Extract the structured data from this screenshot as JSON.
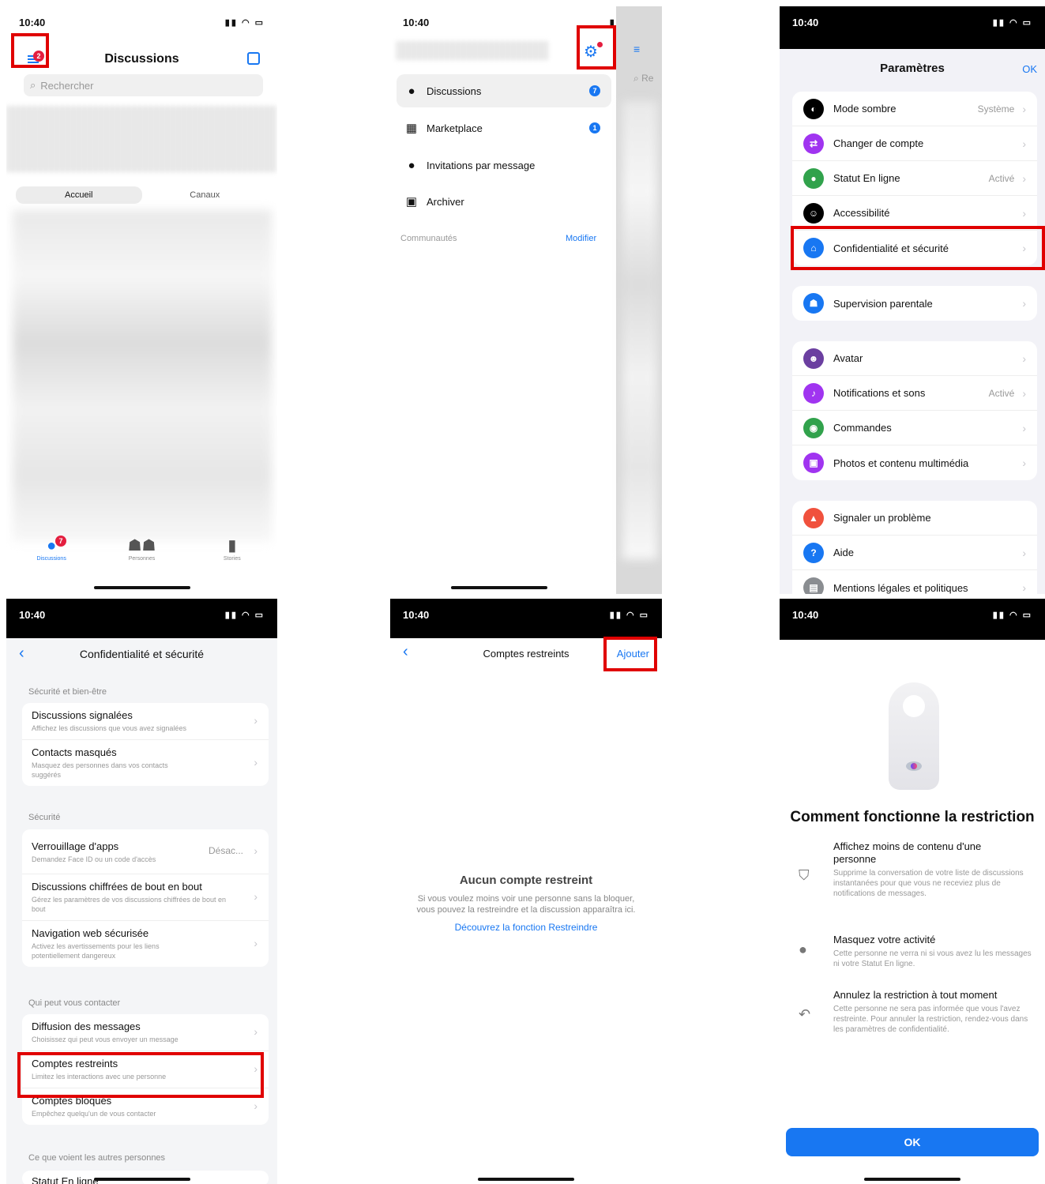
{
  "status_time": "10:40",
  "p1": {
    "title": "Discussions",
    "menu_badge": "2",
    "search_placeholder": "Rechercher",
    "seg_home": "Accueil",
    "seg_channels": "Canaux",
    "tabs": [
      {
        "label": "Discussions",
        "badge": "7"
      },
      {
        "label": "Personnes"
      },
      {
        "label": "Stories"
      }
    ]
  },
  "p2": {
    "items": [
      {
        "label": "Discussions",
        "badge": "7"
      },
      {
        "label": "Marketplace",
        "badge": "1"
      },
      {
        "label": "Invitations par message"
      },
      {
        "label": "Archiver"
      }
    ],
    "communities": "Communautés",
    "modify": "Modifier",
    "peek_search": "Re"
  },
  "p3": {
    "title": "Paramètres",
    "ok": "OK",
    "groups": [
      [
        {
          "label": "Mode sombre",
          "value": "Système",
          "color": "#000000"
        },
        {
          "label": "Changer de compte",
          "value": "",
          "color": "#a034f0"
        },
        {
          "label": "Statut En ligne",
          "value": "Activé",
          "color": "#31a24c"
        },
        {
          "label": "Accessibilité",
          "value": "",
          "color": "#000000"
        },
        {
          "label": "Confidentialité et sécurité",
          "value": "",
          "color": "#1877f2"
        }
      ],
      [
        {
          "label": "Supervision parentale",
          "value": "",
          "color": "#1877f2"
        }
      ],
      [
        {
          "label": "Avatar",
          "value": "",
          "color": "#6b3fa0"
        },
        {
          "label": "Notifications et sons",
          "value": "Activé",
          "color": "#a034f0"
        },
        {
          "label": "Commandes",
          "value": "",
          "color": "#31a24c"
        },
        {
          "label": "Photos et contenu multimédia",
          "value": "",
          "color": "#a034f0"
        }
      ],
      [
        {
          "label": "Signaler un problème",
          "value": "",
          "color": "#f0513d"
        },
        {
          "label": "Aide",
          "value": "",
          "color": "#1877f2"
        },
        {
          "label": "Mentions légales et politiques",
          "value": "",
          "color": "#8a8d91"
        }
      ]
    ]
  },
  "p4": {
    "title": "Confidentialité et sécurité",
    "sections": [
      {
        "label": "Sécurité et bien-être",
        "rows": [
          {
            "title": "Discussions signalées",
            "sub": "Affichez les discussions que vous avez signalées",
            "value": ""
          },
          {
            "title": "Contacts masqués",
            "sub": "Masquez des personnes dans vos contacts suggérés",
            "value": ""
          }
        ]
      },
      {
        "label": "Sécurité",
        "rows": [
          {
            "title": "Verrouillage d'apps",
            "sub": "Demandez Face ID ou un code d'accès",
            "value": "Désac..."
          },
          {
            "title": "Discussions chiffrées de bout en bout",
            "sub": "Gérez les paramètres de vos discussions chiffrées de bout en bout",
            "value": ""
          },
          {
            "title": "Navigation web sécurisée",
            "sub": "Activez les avertissements pour les liens potentiellement dangereux",
            "value": ""
          }
        ]
      },
      {
        "label": "Qui peut vous contacter",
        "rows": [
          {
            "title": "Diffusion des messages",
            "sub": "Choisissez qui peut vous envoyer un message",
            "value": ""
          },
          {
            "title": "Comptes restreints",
            "sub": "Limitez les interactions avec une personne",
            "value": ""
          },
          {
            "title": "Comptes bloqués",
            "sub": "Empêchez quelqu'un de vous contacter",
            "value": ""
          }
        ]
      },
      {
        "label": "Ce que voient les autres personnes",
        "rows": [
          {
            "title": "Statut En ligne",
            "sub": "",
            "value": ""
          }
        ]
      }
    ]
  },
  "p5": {
    "title": "Comptes restreints",
    "add": "Ajouter",
    "empty_title": "Aucun compte restreint",
    "empty_body": "Si vous voulez moins voir une personne sans la bloquer, vous pouvez la restreindre et la discussion apparaîtra ici.",
    "link": "Découvrez la fonction Restreindre"
  },
  "p6": {
    "heading": "Comment fonctionne la restriction",
    "features": [
      {
        "title": "Affichez moins de contenu d'une personne",
        "body": "Supprime la conversation de votre liste de discussions instantanées pour que vous ne receviez plus de notifications de messages.",
        "icon": "shield-icon"
      },
      {
        "title": "Masquez votre activité",
        "body": "Cette personne ne verra ni si vous avez lu les messages ni votre Statut En ligne.",
        "icon": "person-icon"
      },
      {
        "title": "Annulez la restriction à tout moment",
        "body": "Cette personne ne sera pas informée que vous l'avez restreinte. Pour annuler la restriction, rendez-vous dans les paramètres de confidentialité.",
        "icon": "undo-icon"
      }
    ],
    "ok": "OK"
  },
  "colors": {
    "accent": "#1877f2",
    "highlight": "#e00000",
    "badge": "#e41e3f"
  }
}
